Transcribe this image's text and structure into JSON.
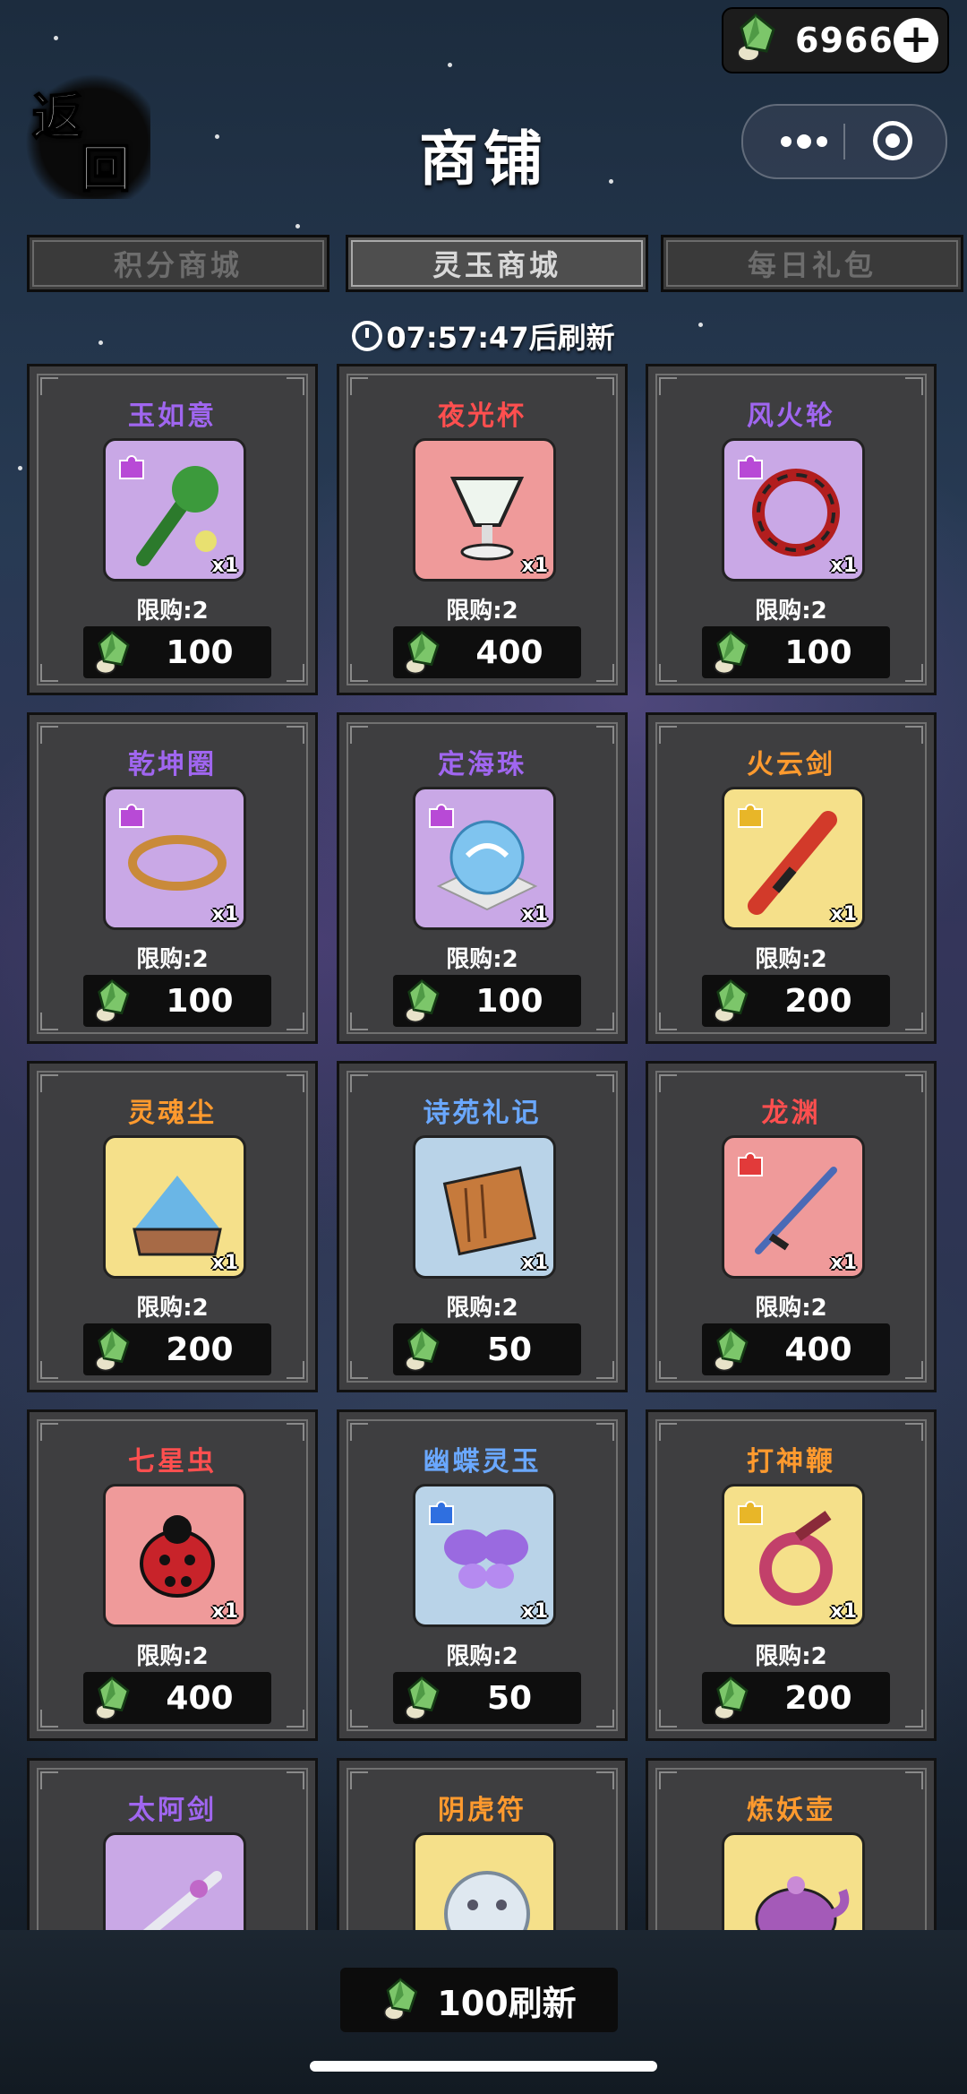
{
  "currency": {
    "value": "6966",
    "add_label": "+"
  },
  "back": {
    "line1": "返",
    "line2": "回"
  },
  "title": "商铺",
  "tabs": [
    {
      "label": "积分商城",
      "active": false
    },
    {
      "label": "灵玉商城",
      "active": true
    },
    {
      "label": "每日礼包",
      "active": false
    }
  ],
  "refresh_timer": "07:57:47后刷新",
  "items": [
    {
      "name": "玉如意",
      "name_color": "#a066f0",
      "bg": "#c9a8e6",
      "qty": "x1",
      "limit": "限购:2",
      "price": "100",
      "piece": "#b84ad6",
      "icon": "ruyi"
    },
    {
      "name": "夜光杯",
      "name_color": "#ff4f4f",
      "bg": "#ef9a9a",
      "qty": "x1",
      "limit": "限购:2",
      "price": "400",
      "piece": "",
      "icon": "cup"
    },
    {
      "name": "风火轮",
      "name_color": "#a066f0",
      "bg": "#c9a8e6",
      "qty": "x1",
      "limit": "限购:2",
      "price": "100",
      "piece": "#b84ad6",
      "icon": "wheel"
    },
    {
      "name": "乾坤圈",
      "name_color": "#a066f0",
      "bg": "#c9a8e6",
      "qty": "x1",
      "limit": "限购:2",
      "price": "100",
      "piece": "#b84ad6",
      "icon": "ring"
    },
    {
      "name": "定海珠",
      "name_color": "#a066f0",
      "bg": "#c9a8e6",
      "qty": "x1",
      "limit": "限购:2",
      "price": "100",
      "piece": "#b84ad6",
      "icon": "pearl"
    },
    {
      "name": "火云剑",
      "name_color": "#ff9a2e",
      "bg": "#f5e08a",
      "qty": "x1",
      "limit": "限购:2",
      "price": "200",
      "piece": "#e8b628",
      "icon": "sword"
    },
    {
      "name": "灵魂尘",
      "name_color": "#ff9a2e",
      "bg": "#f5e08a",
      "qty": "x1",
      "limit": "限购:2",
      "price": "200",
      "piece": "",
      "icon": "dust"
    },
    {
      "name": "诗苑礼记",
      "name_color": "#6aa8ff",
      "bg": "#b9d3e8",
      "qty": "x1",
      "limit": "限购:2",
      "price": "50",
      "piece": "",
      "icon": "scroll"
    },
    {
      "name": "龙渊",
      "name_color": "#ff4f4f",
      "bg": "#ef9a9a",
      "qty": "x1",
      "limit": "限购:2",
      "price": "400",
      "piece": "#e23a3a",
      "icon": "blade"
    },
    {
      "name": "七星虫",
      "name_color": "#ff4f4f",
      "bg": "#ef9a9a",
      "qty": "x1",
      "limit": "限购:2",
      "price": "400",
      "piece": "",
      "icon": "bug"
    },
    {
      "name": "幽蝶灵玉",
      "name_color": "#6aa8ff",
      "bg": "#b9d3e8",
      "qty": "x1",
      "limit": "限购:2",
      "price": "50",
      "piece": "#2f6fe0",
      "icon": "butterfly"
    },
    {
      "name": "打神鞭",
      "name_color": "#ff9a2e",
      "bg": "#f5e08a",
      "qty": "x1",
      "limit": "限购:2",
      "price": "200",
      "piece": "#e8b628",
      "icon": "whip"
    },
    {
      "name": "太阿剑",
      "name_color": "#a066f0",
      "bg": "#c9a8e6",
      "qty": "",
      "limit": "",
      "price": "",
      "piece": "",
      "icon": "sword2"
    },
    {
      "name": "阴虎符",
      "name_color": "#ff9a2e",
      "bg": "#f5e08a",
      "qty": "",
      "limit": "",
      "price": "",
      "piece": "",
      "icon": "tiger"
    },
    {
      "name": "炼妖壶",
      "name_color": "#ff9a2e",
      "bg": "#f5e08a",
      "qty": "",
      "limit": "",
      "price": "",
      "piece": "",
      "icon": "pot"
    }
  ],
  "bottom_refresh": {
    "label": "100刷新"
  }
}
